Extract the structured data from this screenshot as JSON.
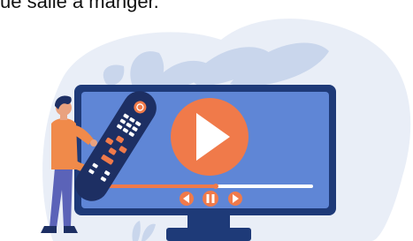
{
  "caption": "ue salle à manger.",
  "illustration": {
    "icons": [
      "person-figure",
      "remote-control-icon",
      "tv-monitor",
      "play-button-icon",
      "rewind-icon",
      "pause-icon",
      "forward-icon",
      "leaf-decoration"
    ],
    "colors": {
      "background_blob": "#e9eef7",
      "leaf": "#c9d6ec",
      "monitor_frame": "#1e3a78",
      "screen": "#5f86d6",
      "play_orange": "#f07a4a",
      "progress_track": "#ffffff",
      "person_shirt": "#f08a4a",
      "person_pants": "#5b63b8",
      "remote_body": "#1d2f63"
    }
  }
}
